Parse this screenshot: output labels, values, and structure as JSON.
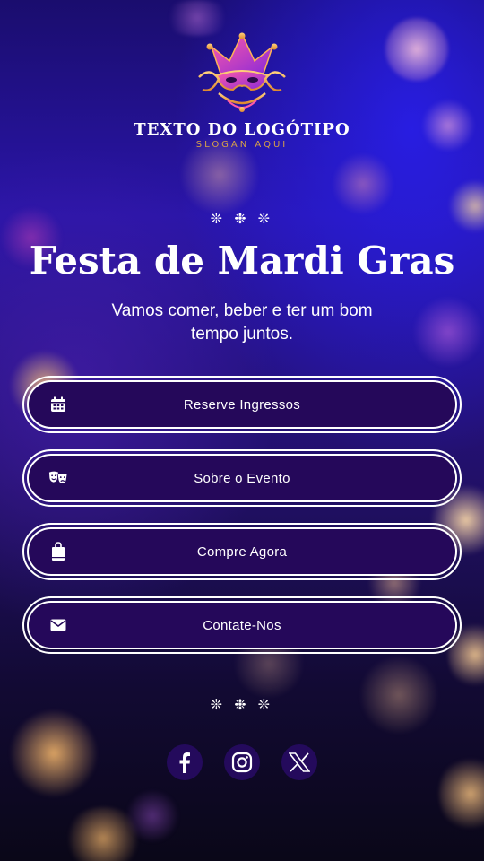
{
  "logo": {
    "text": "TEXTO DO LOGÓTIPO",
    "slogan": "SLOGAN AQUI",
    "icon": "jester-mask-icon"
  },
  "ornament": "❊ ❉ ❊",
  "hero": {
    "title": "Festa de Mardi Gras",
    "subtitle": "Vamos comer, beber e ter um bom tempo juntos."
  },
  "buttons": [
    {
      "label": "Reserve Ingressos",
      "icon": "calendar-icon"
    },
    {
      "label": "Sobre o Evento",
      "icon": "theater-masks-icon"
    },
    {
      "label": "Compre Agora",
      "icon": "shopping-bag-icon"
    },
    {
      "label": "Contate-Nos",
      "icon": "envelope-icon"
    }
  ],
  "socials": [
    {
      "icon": "facebook-icon"
    },
    {
      "icon": "instagram-icon"
    },
    {
      "icon": "x-icon"
    }
  ],
  "colors": {
    "button_fill": "#25085a",
    "button_border": "#ffffff",
    "slogan": "#d6a04a",
    "social_bg": "#240a5c"
  }
}
